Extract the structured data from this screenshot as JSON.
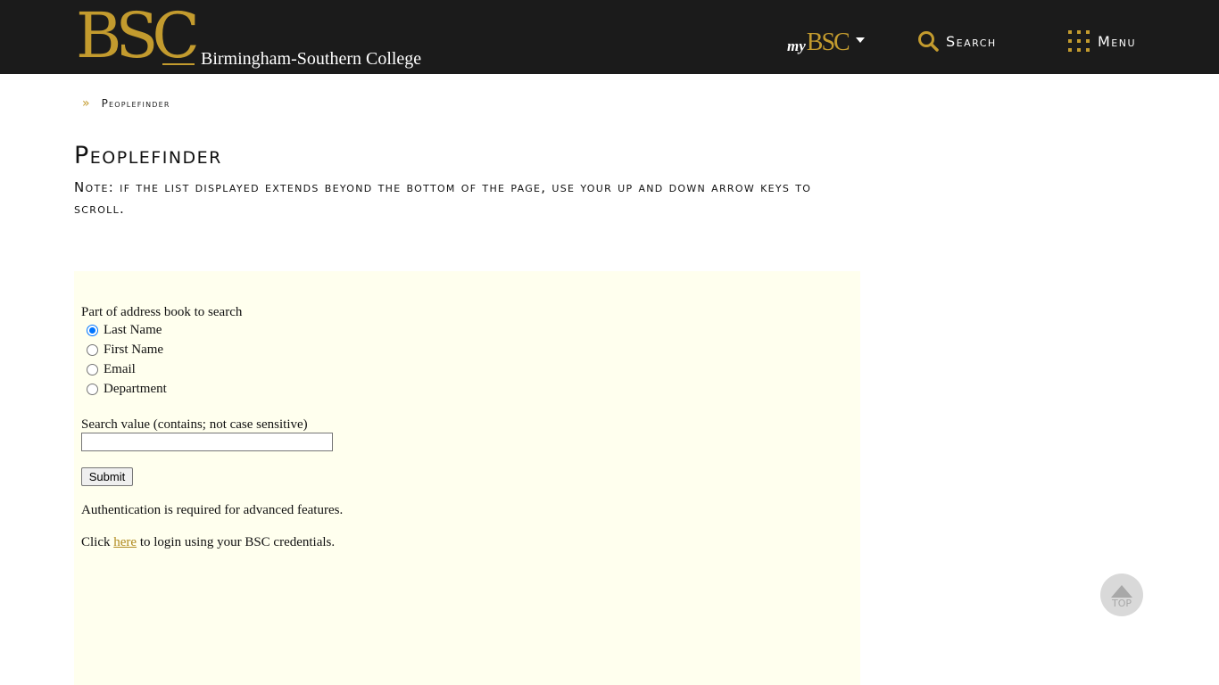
{
  "header": {
    "logo_mark": "BSC",
    "college_name": "Birmingham-Southern College",
    "mybsc": {
      "prefix": "my",
      "name": "BSC"
    },
    "search_label": "Search",
    "menu_label": "Menu",
    "accent_color": "#c39b2e",
    "bar_color": "#1b1b1b"
  },
  "breadcrumb": {
    "icon": "double-chevron-right-icon",
    "current": "Peoplefinder"
  },
  "page": {
    "title": "Peoplefinder",
    "note": "Note: if the list displayed extends beyond the bottom of the page, use your up and down arrow keys to scroll."
  },
  "finder": {
    "panel_color": "#ffffee",
    "scope_label": "Part of address book to search",
    "options": [
      {
        "label": "Last Name",
        "checked": true
      },
      {
        "label": "First Name",
        "checked": false
      },
      {
        "label": "Email",
        "checked": false
      },
      {
        "label": "Department",
        "checked": false
      }
    ],
    "value_label": "Search value (contains; not case sensitive)",
    "value": "",
    "submit_label": "Submit",
    "auth_note": "Authentication is required for advanced features.",
    "login_prefix": "Click ",
    "login_link": "here",
    "login_suffix": " to login using your BSC credentials."
  },
  "back_to_top": {
    "label": "TOP",
    "icon": "up-triangle-icon"
  }
}
